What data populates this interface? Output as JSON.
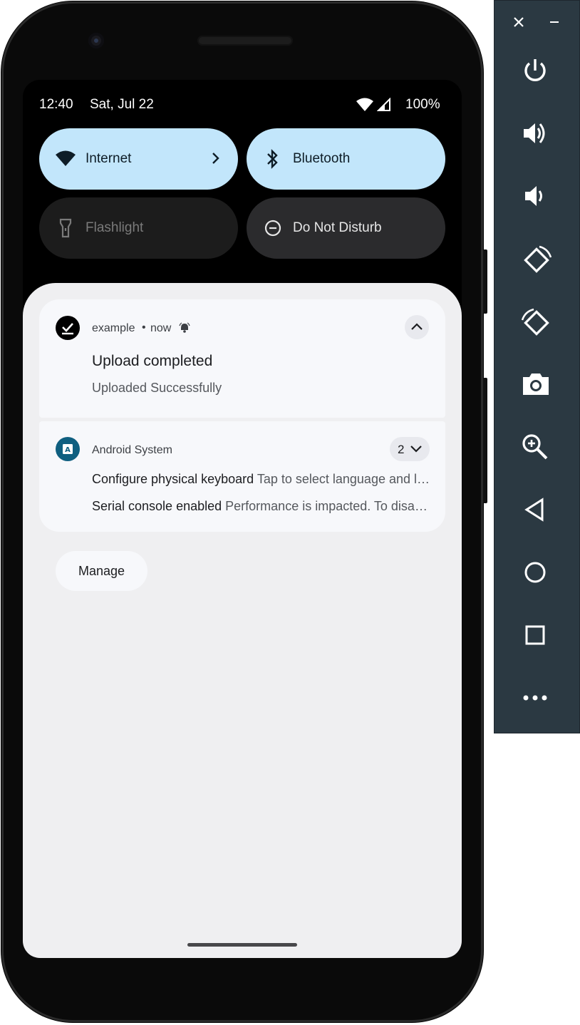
{
  "status_bar": {
    "time": "12:40",
    "date": "Sat, Jul 22",
    "battery": "100%"
  },
  "quick_tiles": [
    {
      "label": "Internet",
      "icon": "wifi-icon",
      "state": "on"
    },
    {
      "label": "Bluetooth",
      "icon": "bluetooth-icon",
      "state": "on"
    },
    {
      "label": "Flashlight",
      "icon": "flashlight-icon",
      "state": "unavailable"
    },
    {
      "label": "Do Not Disturb",
      "icon": "do-not-disturb-icon",
      "state": "off"
    }
  ],
  "notifications": [
    {
      "app": "example",
      "time": "now",
      "title": "Upload completed",
      "text": "Uploaded Successfully"
    },
    {
      "app": "Android System",
      "count": "2",
      "items": [
        {
          "title": "Configure physical keyboard",
          "text": "Tap to select language and layout"
        },
        {
          "title": "Serial console enabled",
          "text": "Performance is impacted. To disable, check bootloader."
        }
      ]
    }
  ],
  "manage_label": "Manage",
  "toolbar": {
    "buttons": [
      "close-icon",
      "minimize-icon",
      "power-icon",
      "volume-up-icon",
      "volume-down-icon",
      "rotate-left-icon",
      "rotate-right-icon",
      "camera-icon",
      "zoom-icon",
      "back-icon",
      "home-icon",
      "overview-icon",
      "more-icon"
    ]
  },
  "colors": {
    "tile_on": "#c2e6fb",
    "shade_bg": "#efeff1",
    "toolbar_bg": "#2b3942",
    "android_system_icon": "#0f5f80"
  }
}
